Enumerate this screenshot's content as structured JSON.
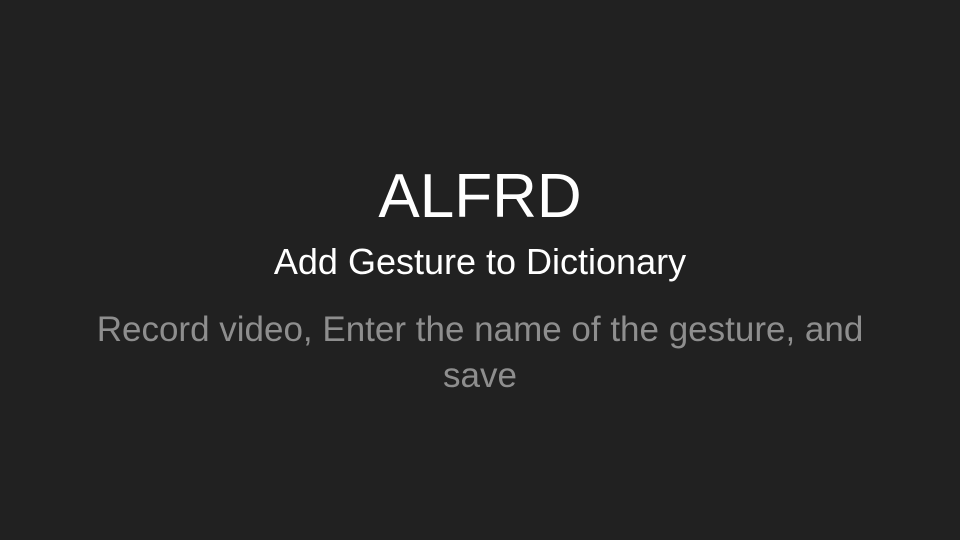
{
  "slide": {
    "title": "ALFRD",
    "subtitle": "Add Gesture to Dictionary",
    "body": "Record video, Enter the name of the gesture, and save"
  },
  "colors": {
    "background": "#212121",
    "title_text": "#ffffff",
    "body_text": "#8e8e8e"
  }
}
